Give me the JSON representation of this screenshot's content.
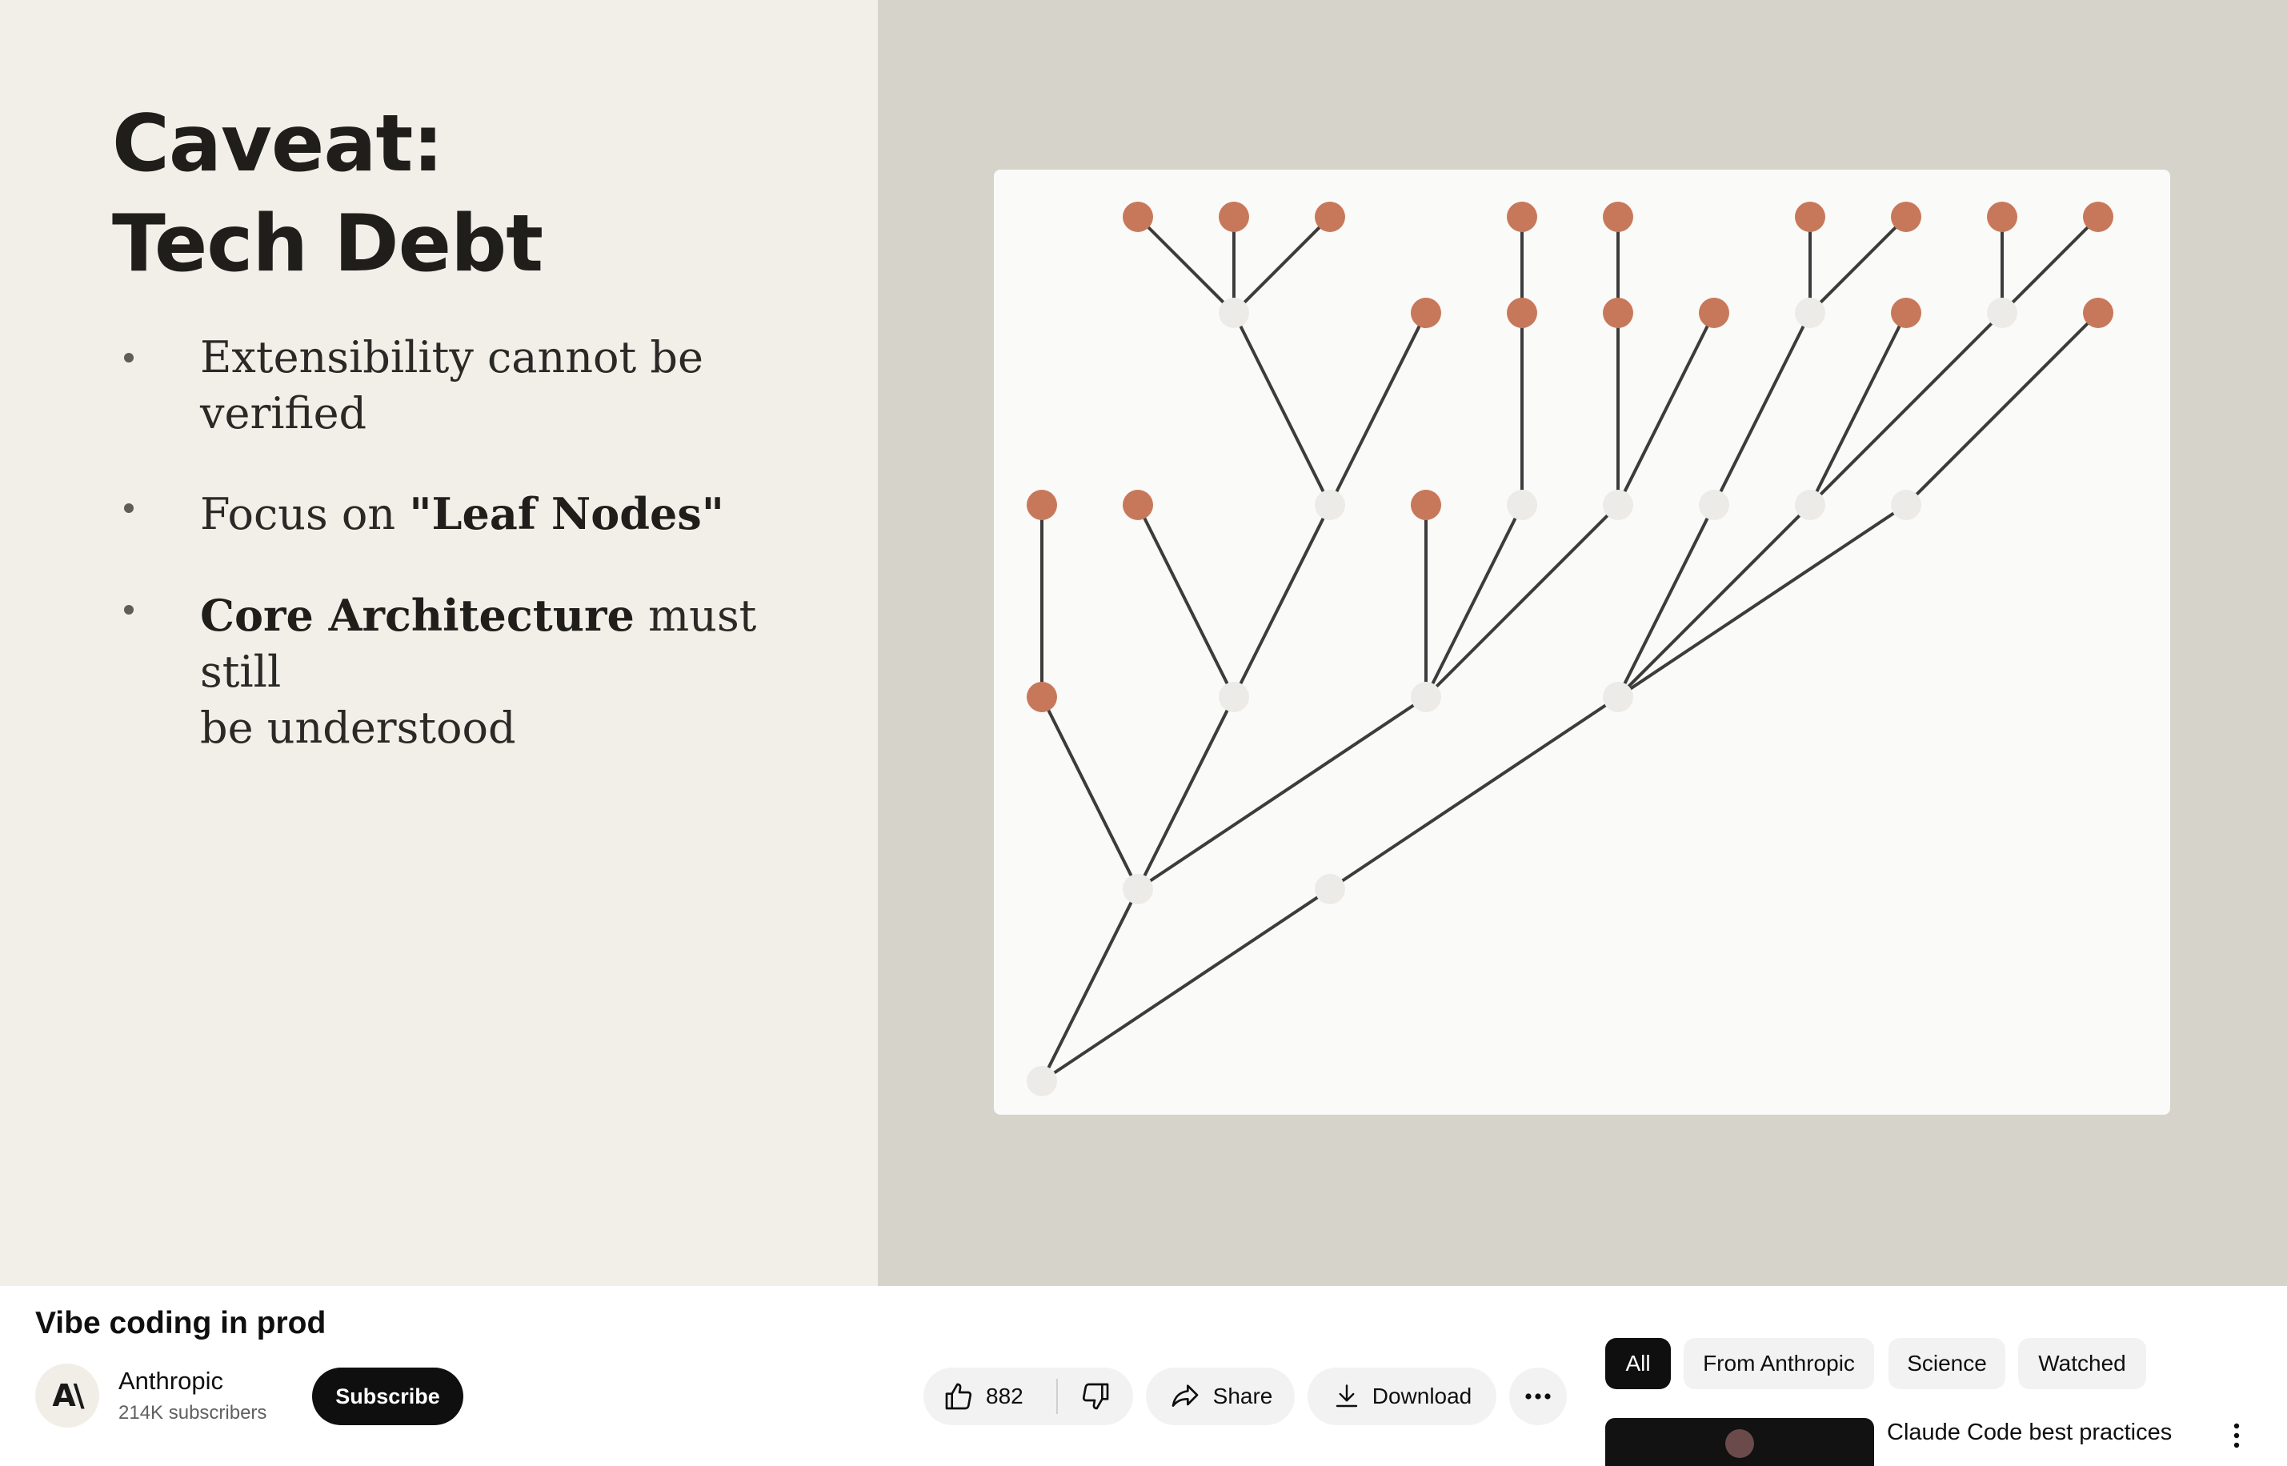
{
  "slide": {
    "title_line1": "Caveat:",
    "title_line2": "Tech Debt",
    "bullets": [
      {
        "plain": "Extensibility cannot be",
        "plain2": "verified"
      },
      {
        "plain": "Focus on ",
        "bold": "\"Leaf Nodes\""
      },
      {
        "bold": "Core Architecture",
        "plain": " must still",
        "plain2": "be understood"
      }
    ],
    "colors": {
      "leaf": "#c8785a",
      "internal": "#ecebe7",
      "edge": "#3c3c3c"
    }
  },
  "video": {
    "title": "Vibe coding in prod"
  },
  "channel": {
    "name": "Anthropic",
    "subscribers": "214K subscribers",
    "avatar_text": "A\\",
    "subscribe_label": "Subscribe"
  },
  "actions": {
    "like_count": "882",
    "share_label": "Share",
    "download_label": "Download"
  },
  "chips": [
    "All",
    "From Anthropic",
    "Science",
    "Watched"
  ],
  "recommendation": {
    "title": "Claude Code best practices"
  }
}
